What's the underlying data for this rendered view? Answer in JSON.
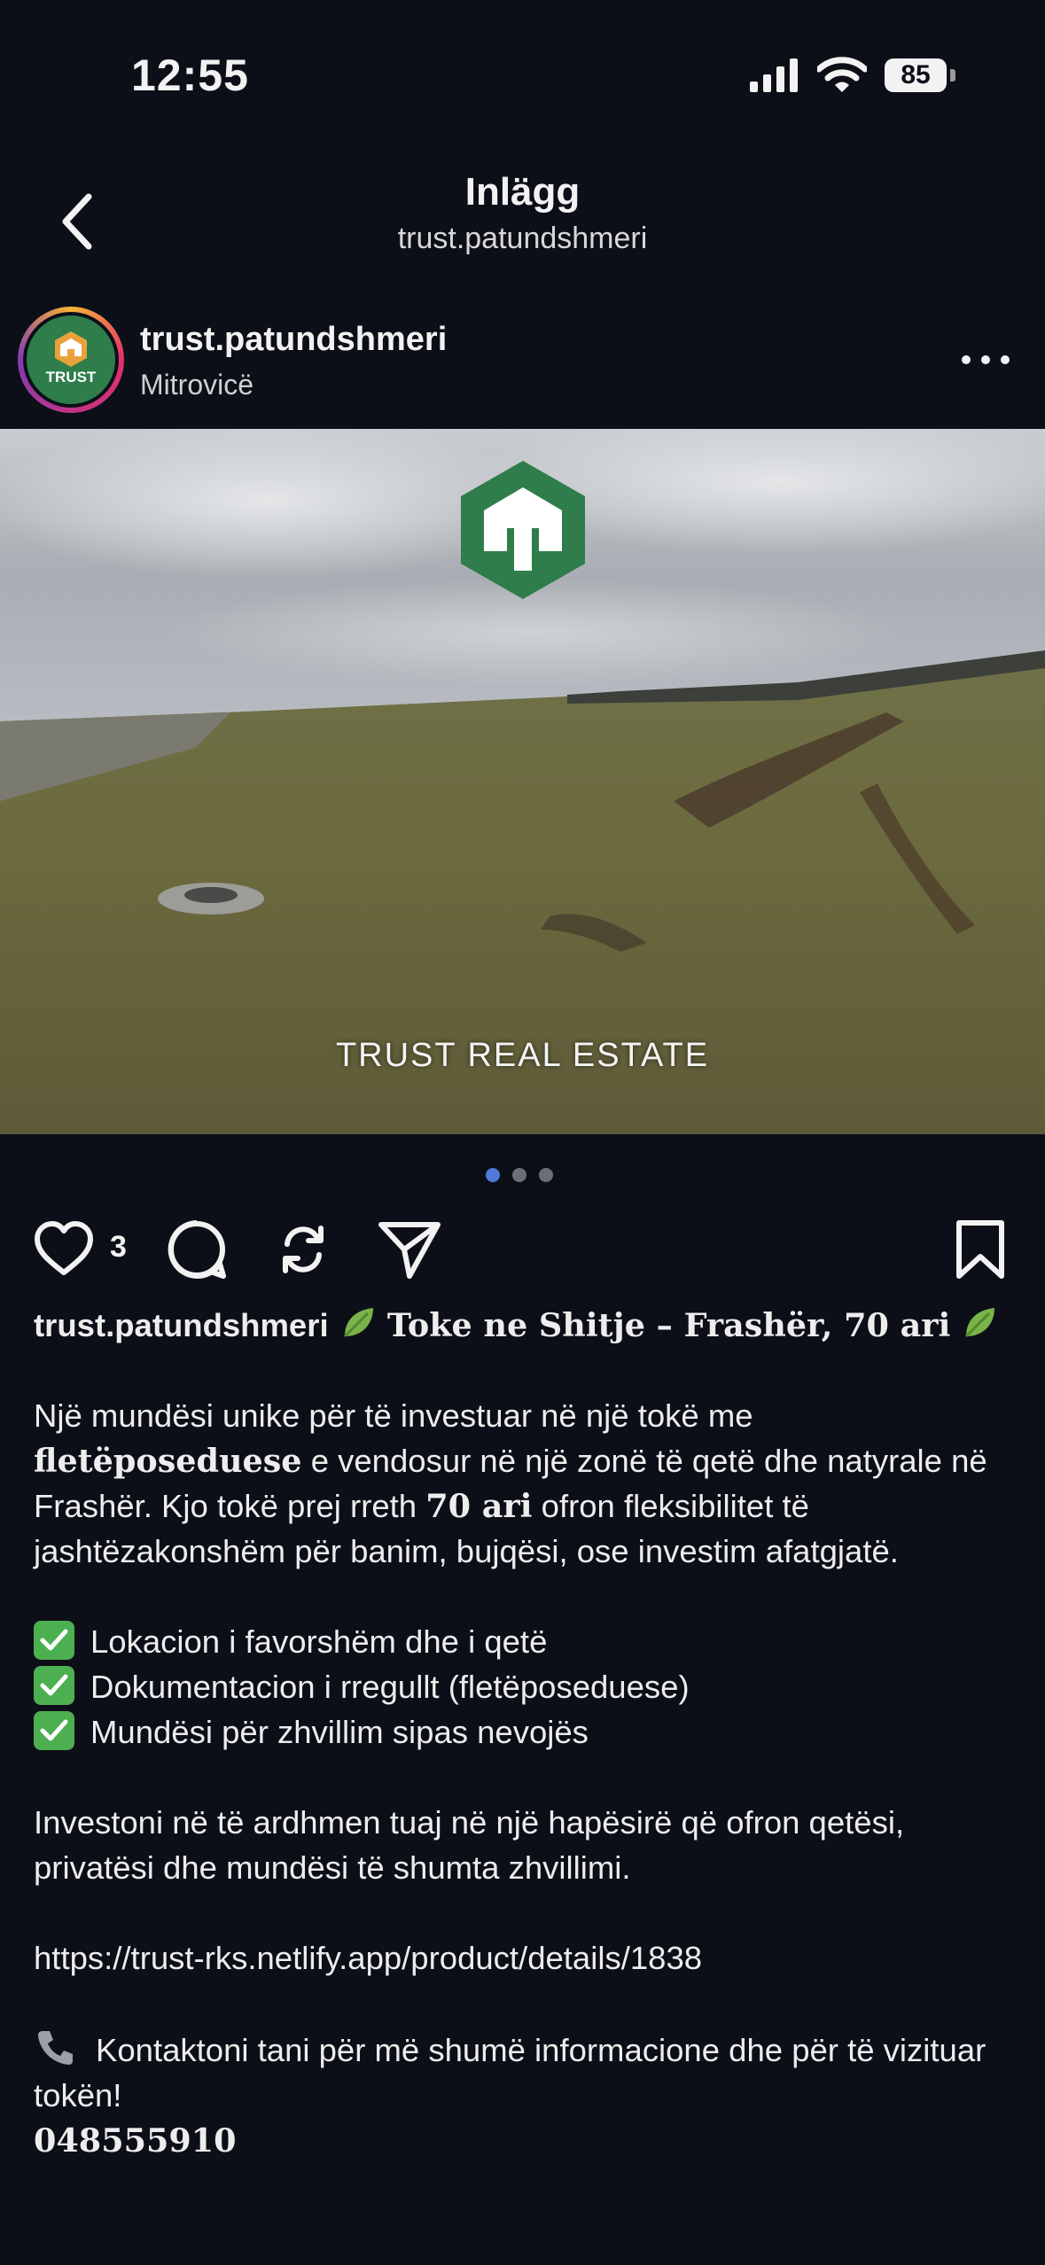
{
  "status_bar": {
    "time": "12:55",
    "battery": "85"
  },
  "nav": {
    "title": "Inlägg",
    "subtitle": "trust.patundshmeri"
  },
  "post": {
    "avatar_text": "TRUST",
    "username": "trust.patundshmeri",
    "location": "Mitrovicë",
    "image_watermark": "TRUST REAL ESTATE",
    "carousel": {
      "count": 3,
      "active": 0
    },
    "likes": "3"
  },
  "caption": {
    "username": "trust.patundshmeri",
    "headline": "Toke ne Shitje – Frashër, 70 ari",
    "p1_a": "Një mundësi unike për të investuar në një tokë me ",
    "p1_b": "fletëposeduese",
    "p1_c": " e vendosur në një zonë të qetë dhe natyrale në Frashër. Kjo tokë prej rreth ",
    "p1_d": "70 ari",
    "p1_e": " ofron fleksibilitet të jashtëzakonshëm për banim, bujqësi, ose investim afatgjatë.",
    "checks": [
      "Lokacion i favorshëm dhe i qetë",
      "Dokumentacion i rregullt (fletëposeduese)",
      "Mundësi për zhvillim sipas nevojës"
    ],
    "p2": "Investoni në të ardhmen tuaj në një hapësirë që ofron qetësi, privatësi dhe mundësi të shumta zhvillimi.",
    "link": "https://trust-rks.netlify.app/product/details/1838",
    "contact": "Kontaktoni tani për më shumë informacione dhe për të vizituar tokën!",
    "phone": "048555910"
  },
  "colors": {
    "background": "#0c0f18",
    "brand_green": "#2e7d4b",
    "check_green": "#4caf50",
    "active_dot": "#4e7bd8"
  }
}
